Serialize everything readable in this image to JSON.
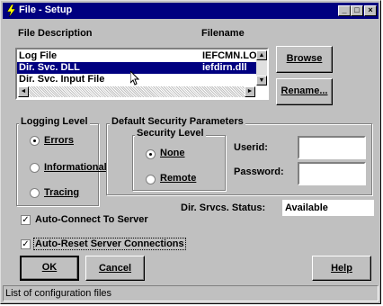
{
  "window": {
    "title": "File - Setup"
  },
  "titlebar_buttons": {
    "minimize": "_",
    "maximize": "□",
    "close": "×"
  },
  "headers": {
    "file_description": "File Description",
    "filename": "Filename"
  },
  "files": [
    {
      "description": "Log File",
      "filename": "IEFCMN.LO"
    },
    {
      "description": "Dir. Svc. DLL",
      "filename": "iefdirn.dll"
    },
    {
      "description": "Dir. Svc. Input File",
      "filename": ""
    }
  ],
  "scroll_arrows": {
    "up": "▲",
    "down": "▼",
    "left": "◄",
    "right": "►"
  },
  "buttons": {
    "browse": "Browse",
    "rename": "Rename...",
    "ok": "OK",
    "cancel": "Cancel",
    "help": "Help"
  },
  "logging": {
    "title": "Logging Level",
    "options": [
      "Errors",
      "Informational",
      "Tracing"
    ],
    "selected": "Errors"
  },
  "security": {
    "title": "Default Security Parameters",
    "level_title": "Security Level",
    "levels": [
      "None",
      "Remote"
    ],
    "selected": "None",
    "userid_label": "Userid:",
    "password_label": "Password:",
    "userid_value": "",
    "password_value": ""
  },
  "dir_status": {
    "label": "Dir. Srvcs. Status:",
    "value": "Available"
  },
  "checkboxes": {
    "auto_connect": "Auto-Connect To Server",
    "auto_reset": "Auto-Reset Server Connections",
    "checkmark": "✓"
  },
  "status_bar": "List of configuration files"
}
